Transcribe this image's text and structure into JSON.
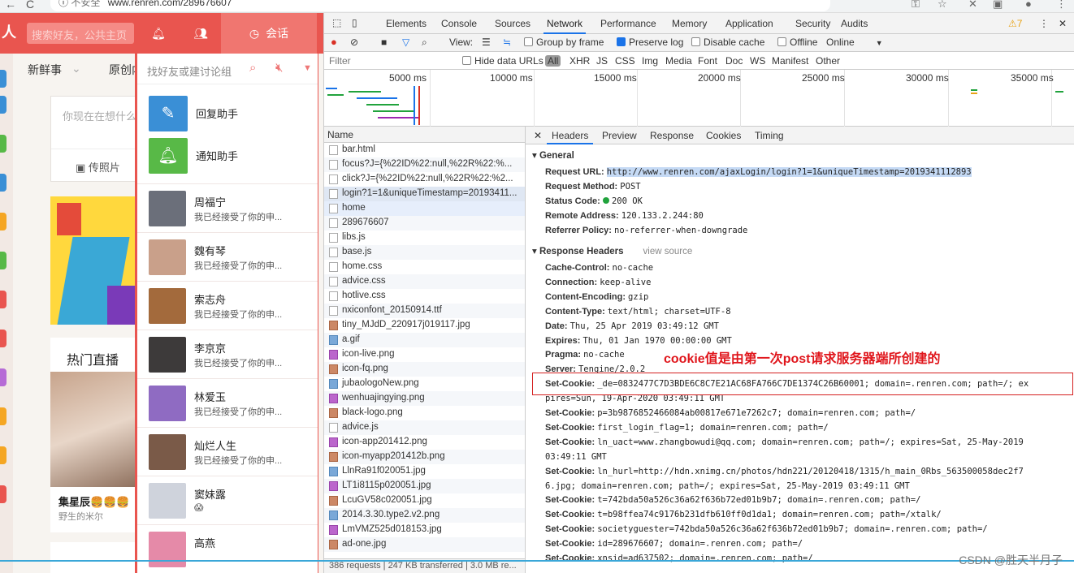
{
  "browser": {
    "back": "←",
    "reload": "C",
    "info": "ⓘ",
    "security": "不安全",
    "url": "www.renren.com/289676607"
  },
  "renren": {
    "search_placeholder": "搜索好友，公共主页",
    "tab_chat": "会话",
    "subnav_first": "新鲜事",
    "subnav_second": "原创内",
    "status_placeholder": "你现在在想什么",
    "photo_button": "传照片",
    "live_title": "热门直播",
    "live_name": "集星辰🍔🍔🍔",
    "live_sub": "野生的米尔",
    "chat_search_placeholder": "找好友或建讨论组",
    "helpers": [
      {
        "label": "回复助手",
        "color": "#3a8fd6"
      },
      {
        "label": "通知助手",
        "color": "#58b947"
      }
    ],
    "contacts": [
      {
        "name": "周福宁",
        "msg": "我已经接受了你的申..."
      },
      {
        "name": "魏有琴",
        "msg": "我已经接受了你的申..."
      },
      {
        "name": "索志舟",
        "msg": "我已经接受了你的申..."
      },
      {
        "name": "李京京",
        "msg": "我已经接受了你的申..."
      },
      {
        "name": "林爱玉",
        "msg": "我已经接受了你的申..."
      },
      {
        "name": "灿烂人生",
        "msg": "我已经接受了你的申..."
      },
      {
        "name": "窦妹露",
        "msg": "😱"
      },
      {
        "name": "高燕",
        "msg": ""
      }
    ]
  },
  "devtools": {
    "tabs": [
      "Elements",
      "Console",
      "Sources",
      "Network",
      "Performance",
      "Memory",
      "Application",
      "Security",
      "Audits"
    ],
    "active_tab": "Network",
    "warnings": "⚠7",
    "toolbar": {
      "view": "View:",
      "group_by_frame": "Group by frame",
      "preserve_log": "Preserve log",
      "disable_cache": "Disable cache",
      "offline": "Offline",
      "online": "Online"
    },
    "filter": {
      "placeholder": "Filter",
      "hide_data_urls": "Hide data URLs",
      "types": [
        "All",
        "XHR",
        "JS",
        "CSS",
        "Img",
        "Media",
        "Font",
        "Doc",
        "WS",
        "Manifest",
        "Other"
      ]
    },
    "timeline_labels": [
      "5000 ms",
      "10000 ms",
      "15000 ms",
      "20000 ms",
      "25000 ms",
      "30000 ms",
      "35000 ms"
    ],
    "name_header": "Name",
    "requests": [
      "bar.html",
      "focus?J={%22ID%22:null,%22R%22:%...",
      "click?J={%22ID%22:null,%22R%22:%2...",
      "login?1=1&uniqueTimestamp=20193411...",
      "home",
      "289676607",
      "libs.js",
      "base.js",
      "home.css",
      "advice.css",
      "hotlive.css",
      "nxiconfont_20150914.ttf",
      "tiny_MJdD_220917j019117.jpg",
      "a.gif",
      "icon-live.png",
      "icon-fq.png",
      "jubaologoNew.png",
      "wenhuajingying.png",
      "black-logo.png",
      "advice.js",
      "icon-app201412.png",
      "icon-myapp201412b.png",
      "LlnRa91f020051.jpg",
      "LT1i8115p020051.jpg",
      "LcuGV58c020051.jpg",
      "2014.3.30.type2.v2.png",
      "LmVMZ525d018153.jpg",
      "ad-one.jpg"
    ],
    "status_bar": "386 requests | 247 KB transferred | 3.0 MB re...",
    "detail_tabs": [
      "Headers",
      "Preview",
      "Response",
      "Cookies",
      "Timing"
    ],
    "general": {
      "title": "General",
      "rows": [
        {
          "k": "Request URL:",
          "v": "http://www.renren.com/ajaxLogin/login?1=1&uniqueTimestamp=2019341112893"
        },
        {
          "k": "Request Method:",
          "v": "POST"
        },
        {
          "k": "Status Code:",
          "v": "200 OK"
        },
        {
          "k": "Remote Address:",
          "v": "120.133.2.244:80"
        },
        {
          "k": "Referrer Policy:",
          "v": "no-referrer-when-downgrade"
        }
      ]
    },
    "response_headers": {
      "title": "Response Headers",
      "view_source": "view source",
      "rows": [
        {
          "k": "Cache-Control:",
          "v": "no-cache"
        },
        {
          "k": "Connection:",
          "v": "keep-alive"
        },
        {
          "k": "Content-Encoding:",
          "v": "gzip"
        },
        {
          "k": "Content-Type:",
          "v": "text/html; charset=UTF-8"
        },
        {
          "k": "Date:",
          "v": "Thu, 25 Apr 2019 03:49:12 GMT"
        },
        {
          "k": "Expires:",
          "v": "Thu, 01 Jan 1970 00:00:00 GMT"
        },
        {
          "k": "Pragma:",
          "v": "no-cache"
        },
        {
          "k": "Server:",
          "v": "Tengine/2.0.2"
        },
        {
          "k": "Set-Cookie:",
          "v": "_de=0832477C7D3BDE6C8C7E21AC68FA766C7DE1374C26B60001; domain=.renren.com; path=/; ex"
        },
        {
          "k": "",
          "v": "pires=Sun, 19-Apr-2020 03:49:11 GMT"
        },
        {
          "k": "Set-Cookie:",
          "v": "p=3b9876852466084ab00817e671e7262c7; domain=renren.com; path=/"
        },
        {
          "k": "Set-Cookie:",
          "v": "first_login_flag=1; domain=renren.com; path=/"
        },
        {
          "k": "Set-Cookie:",
          "v": "ln_uact=www.zhangbowudi@qq.com; domain=renren.com; path=/; expires=Sat, 25-May-2019"
        },
        {
          "k": "",
          "v": "03:49:11 GMT"
        },
        {
          "k": "Set-Cookie:",
          "v": "ln_hurl=http://hdn.xnimg.cn/photos/hdn221/20120418/1315/h_main_0Rbs_563500058dec2f7"
        },
        {
          "k": "",
          "v": "6.jpg; domain=renren.com; path=/; expires=Sat, 25-May-2019 03:49:11 GMT"
        },
        {
          "k": "Set-Cookie:",
          "v": "t=742bda50a526c36a62f636b72ed01b9b7; domain=.renren.com; path=/"
        },
        {
          "k": "Set-Cookie:",
          "v": "t=b98ffea74c9176b231dfb610ff0d1da1; domain=renren.com; path=/xtalk/"
        },
        {
          "k": "Set-Cookie:",
          "v": "societyguester=742bda50a526c36a62f636b72ed01b9b7; domain=.renren.com; path=/"
        },
        {
          "k": "Set-Cookie:",
          "v": "id=289676607; domain=.renren.com; path=/"
        },
        {
          "k": "Set-Cookie:",
          "v": "xnsid=ad637502; domain=.renren.com; path=/"
        }
      ]
    },
    "annotation": "cookie值是由第一次post请求服务器端所创建的"
  },
  "watermark": "CSDN @胜天半月子"
}
